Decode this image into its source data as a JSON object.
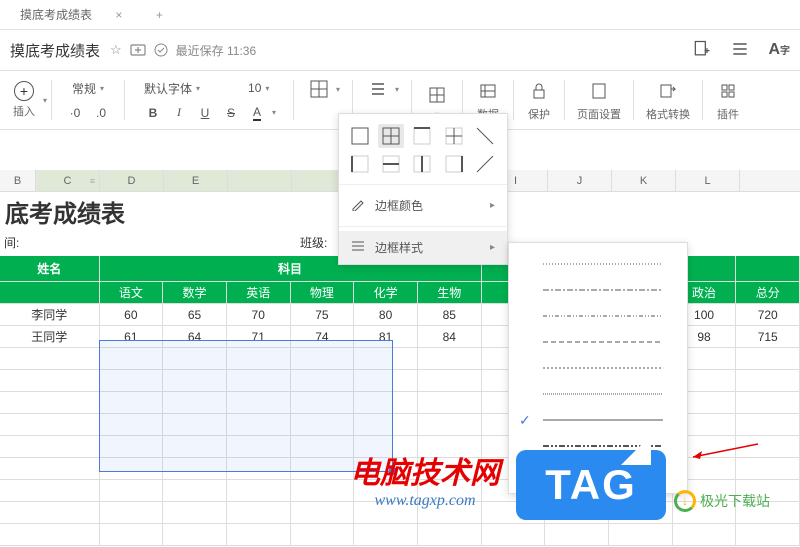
{
  "tab": {
    "title": "摸底考成绩表"
  },
  "doc": {
    "title": "摸底考成绩表",
    "saveText": "最近保存 11:36"
  },
  "toolbar": {
    "insert": "插入",
    "style": "常规",
    "font": "默认字体",
    "size": "10",
    "bold": "B",
    "italic": "I",
    "underline": "U",
    "strike": "S",
    "data": "数据",
    "protect": "保护",
    "pageSetup": "页面设置",
    "formatConvert": "格式转换",
    "plugin": "插件"
  },
  "borderMenu": {
    "colorLabel": "边框颜色",
    "styleLabel": "边框样式"
  },
  "sheet": {
    "bigTitle": "底考成绩表",
    "metaTime": "间:",
    "metaClass": "班级:",
    "columns": [
      "B",
      "C",
      "D",
      "E",
      "",
      "",
      "",
      "",
      "I",
      "J",
      "K",
      "L"
    ],
    "header1": {
      "name": "姓名",
      "subject": "科目"
    },
    "header2": [
      "语文",
      "数学",
      "英语",
      "物理",
      "化学",
      "生物",
      "",
      "",
      "政治",
      "总分"
    ],
    "rows": [
      {
        "name": "李同学",
        "vals": [
          "60",
          "65",
          "70",
          "75",
          "80",
          "85",
          "",
          "",
          "100",
          "720"
        ]
      },
      {
        "name": "王同学",
        "vals": [
          "61",
          "64",
          "71",
          "74",
          "81",
          "84",
          "",
          "",
          "98",
          "715"
        ]
      }
    ]
  },
  "watermark": {
    "line1": "电脑技术网",
    "line2": "www.tagxp.com",
    "tag": "TAG",
    "site": "极光下载站"
  }
}
